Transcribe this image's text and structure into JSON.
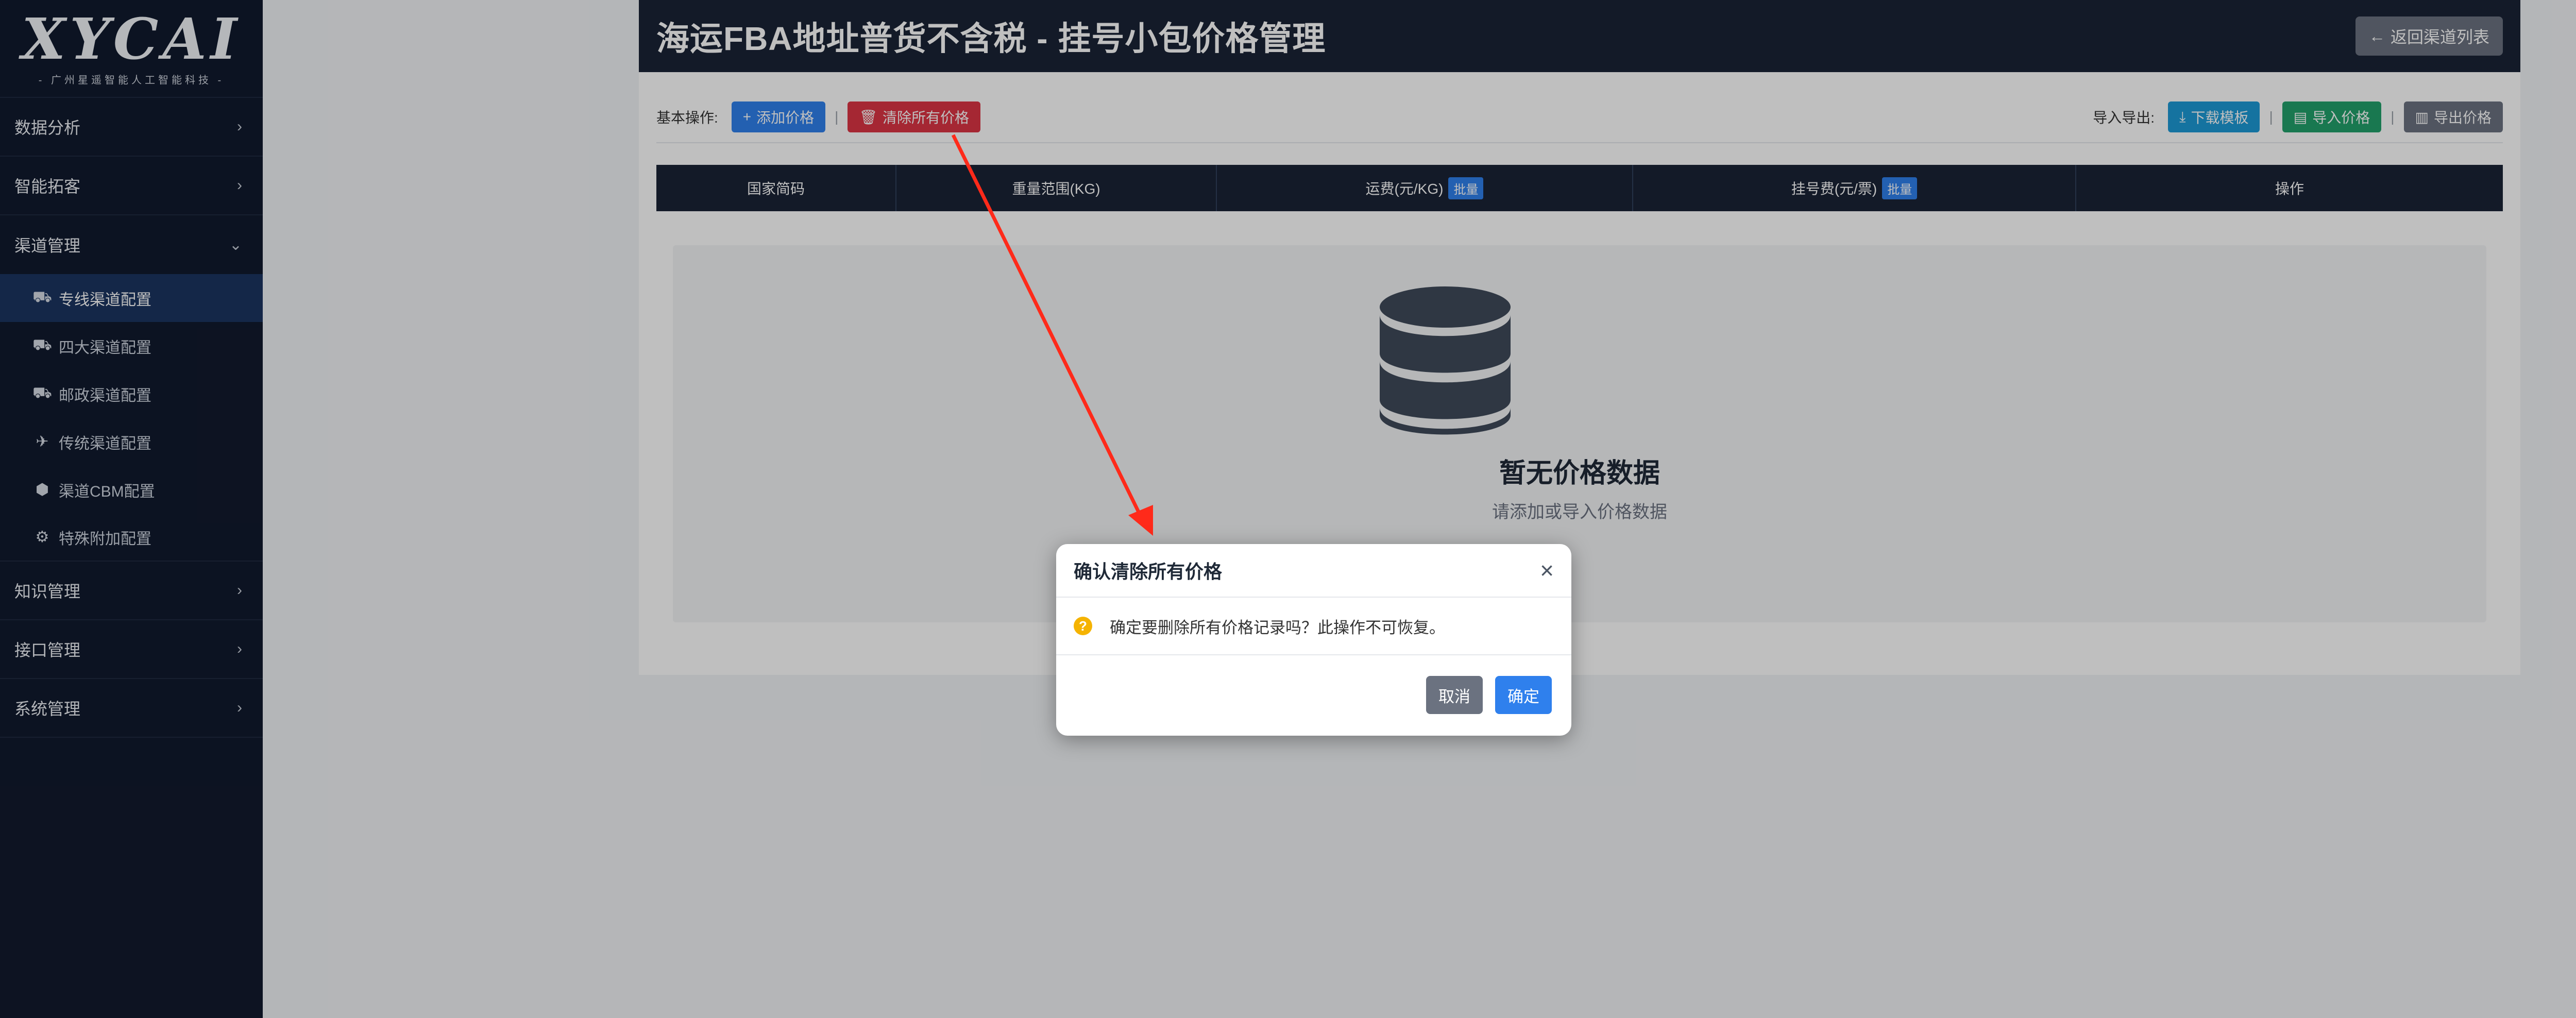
{
  "sidebar": {
    "logo_text": "XYCAI",
    "logo_sub": "- 广州星遥智能人工智能科技 -",
    "groups": [
      {
        "label": "数据分析"
      },
      {
        "label": "智能拓客"
      },
      {
        "label": "渠道管理"
      },
      {
        "label": "知识管理"
      },
      {
        "label": "接口管理"
      },
      {
        "label": "系统管理"
      }
    ],
    "sub_items": [
      {
        "label": "专线渠道配置",
        "icon": "truck-icon"
      },
      {
        "label": "四大渠道配置",
        "icon": "truck-icon"
      },
      {
        "label": "邮政渠道配置",
        "icon": "truck-icon"
      },
      {
        "label": "传统渠道配置",
        "icon": "plane-icon"
      },
      {
        "label": "渠道CBM配置",
        "icon": "box-icon"
      },
      {
        "label": "特殊附加配置",
        "icon": "gear-icon"
      }
    ]
  },
  "header": {
    "title": "海运FBA地址普货不含税 - 挂号小包价格管理",
    "back_label": "返回渠道列表"
  },
  "toolbar": {
    "basic_label": "基本操作:",
    "add_label": "添加价格",
    "clear_label": "清除所有价格",
    "io_label": "导入导出:",
    "download_label": "下载模板",
    "import_label": "导入价格",
    "export_label": "导出价格"
  },
  "table": {
    "columns": [
      "国家简码",
      "重量范围(KG)",
      "运费(元/KG)",
      "挂号费(元/票)",
      "操作"
    ],
    "batch_label": "批量"
  },
  "empty": {
    "title": "暂无价格数据",
    "subtitle": "请添加或导入价格数据"
  },
  "modal": {
    "title": "确认清除所有价格",
    "close": "×",
    "message": "确定要删除所有价格记录吗？此操作不可恢复。",
    "cancel_label": "取消",
    "confirm_label": "确定"
  },
  "colors": {
    "sidebar_bg": "#111a2e",
    "header_bg": "#1a2336",
    "primary": "#2f80ed",
    "danger": "#dc3545",
    "success": "#22a06b",
    "annotation_arrow": "#ff2a1a"
  }
}
